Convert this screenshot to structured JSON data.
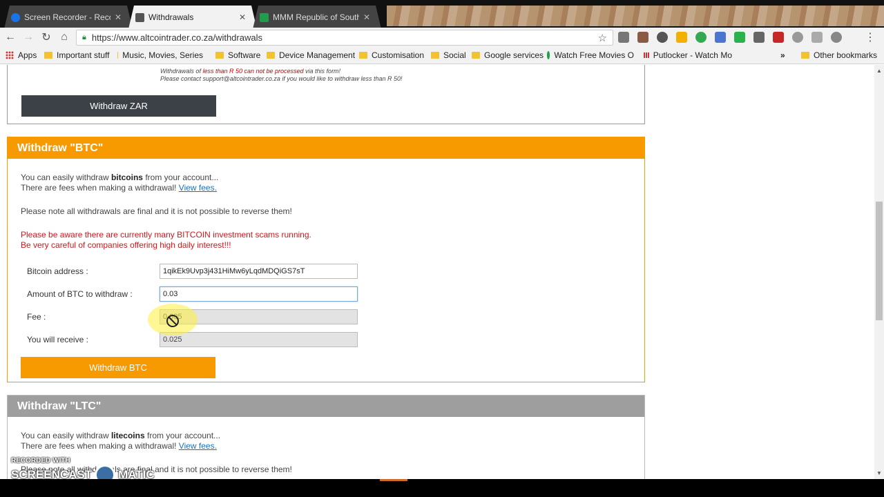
{
  "tabs": [
    {
      "label": "Screen Recorder - Record",
      "active": false
    },
    {
      "label": "Withdrawals",
      "active": true
    },
    {
      "label": "MMM Republic of South",
      "active": false
    }
  ],
  "toolbar": {
    "url": "https://www.altcointrader.co.za/withdrawals"
  },
  "bookmarks": [
    "Apps",
    "Important stuff",
    "Music, Movies, Series",
    "Software",
    "Device Management",
    "Customisation",
    "Social",
    "Google services",
    "Watch Free Movies O",
    "Putlocker - Watch Mo"
  ],
  "bookmarks_more": "»",
  "bookmarks_other": "Other bookmarks",
  "zar": {
    "note_prefix": "Withdrawals of ",
    "note_red": "less than R 50 can not be processed",
    "note_suffix": " via this form!",
    "note_line2": "Please contact support@altcointrader.co.za if you would like to withdraw less than R 50!",
    "button": "Withdraw ZAR"
  },
  "btc": {
    "title": "Withdraw \"BTC\"",
    "intro_prefix": "You can easily withdraw ",
    "intro_bold": "bitcoins",
    "intro_suffix": " from your account...",
    "fees_prefix": "There are fees when making a withdrawal! ",
    "fees_link": "View fees.",
    "final_note": "Please note all withdrawals are final and it is not possible to reverse them!",
    "warning_1": "Please be aware there are currently many BITCOIN investment scams running.",
    "warning_2": "Be very careful of companies offering high daily interest!!!",
    "address_label": "Bitcoin address :",
    "address_value": "1qikEk9Uvp3j431HiMw6yLqdMDQiGS7sT",
    "amount_label": "Amount of BTC to withdraw :",
    "amount_value": "0.03",
    "fee_label": "Fee :",
    "fee_value": "0.005",
    "receive_label": "You will receive :",
    "receive_value": "0.025",
    "button": "Withdraw BTC"
  },
  "ltc": {
    "title": "Withdraw \"LTC\"",
    "intro_prefix": "You can easily withdraw ",
    "intro_bold": "litecoins",
    "intro_suffix": " from your account...",
    "fees_prefix": "There are fees when making a withdrawal! ",
    "fees_link": "View fees.",
    "final_note": "Please note all withdrawals are final and it is not possible to reverse them!"
  },
  "watermark": {
    "line1": "RECORDED WITH",
    "line2a": "SCREENCAST",
    "line2b": "MATIC"
  },
  "colors": {
    "btc_orange": "#f79a00",
    "zar_button": "#3b4147",
    "warning_red": "#d0171b",
    "link_blue": "#1a6fbf"
  }
}
